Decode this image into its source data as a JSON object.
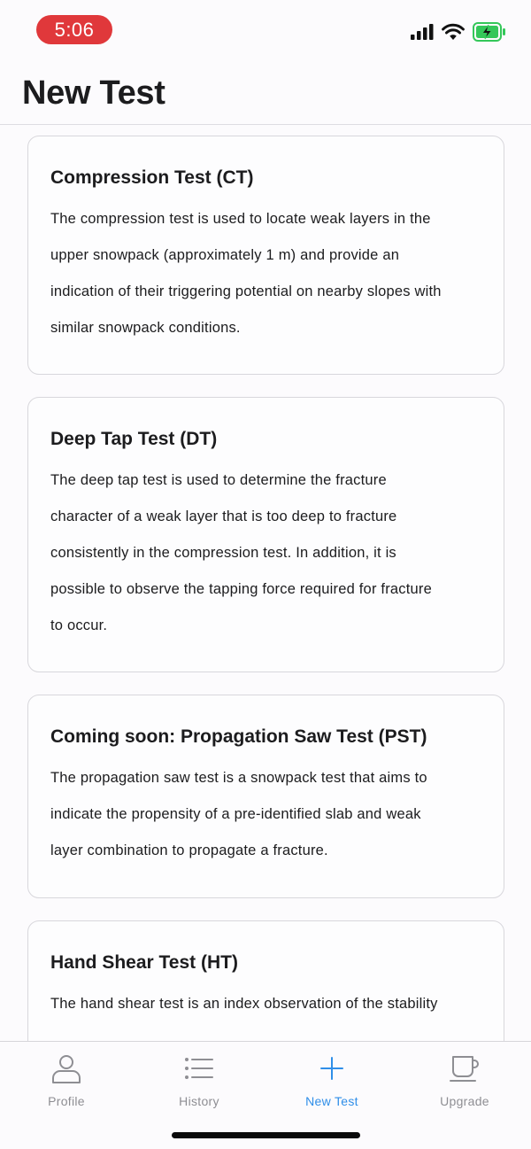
{
  "status_bar": {
    "time": "5:06",
    "icons": [
      "cellular-signal-icon",
      "wifi-icon",
      "battery-charging-icon"
    ]
  },
  "header": {
    "title": "New Test"
  },
  "cards": [
    {
      "title": "Compression Test (CT)",
      "lines": [
        "The compression test is used to locate weak layers in the",
        "upper snowpack (approximately 1 m) and provide an",
        "indication of their triggering potential on nearby slopes with",
        "similar snowpack conditions."
      ]
    },
    {
      "title": "Deep Tap Test (DT)",
      "lines": [
        "The deep tap test is used to determine the fracture",
        "character of a weak layer that is too deep to fracture",
        "consistently in the compression test. In addition, it is",
        "possible to observe the tapping force required for fracture",
        "to occur."
      ]
    },
    {
      "title": "Coming soon: Propagation Saw Test (PST)",
      "lines": [
        "The propagation saw test is a snowpack test that aims to",
        "indicate the propensity of a pre-identified slab and weak",
        "layer combination to propagate a fracture."
      ]
    },
    {
      "title": "Hand Shear Test (HT)",
      "lines": [
        "The hand shear test is an index observation of the stability"
      ]
    }
  ],
  "tab_bar": {
    "tabs": [
      {
        "label": "Profile",
        "icon": "person-icon"
      },
      {
        "label": "History",
        "icon": "list-icon"
      },
      {
        "label": "New Test",
        "icon": "plus-icon"
      },
      {
        "label": "Upgrade",
        "icon": "coffee-cup-icon"
      }
    ],
    "active": "New Test",
    "active_color": "#2f8ee8",
    "inactive_color": "#8e8e93"
  }
}
